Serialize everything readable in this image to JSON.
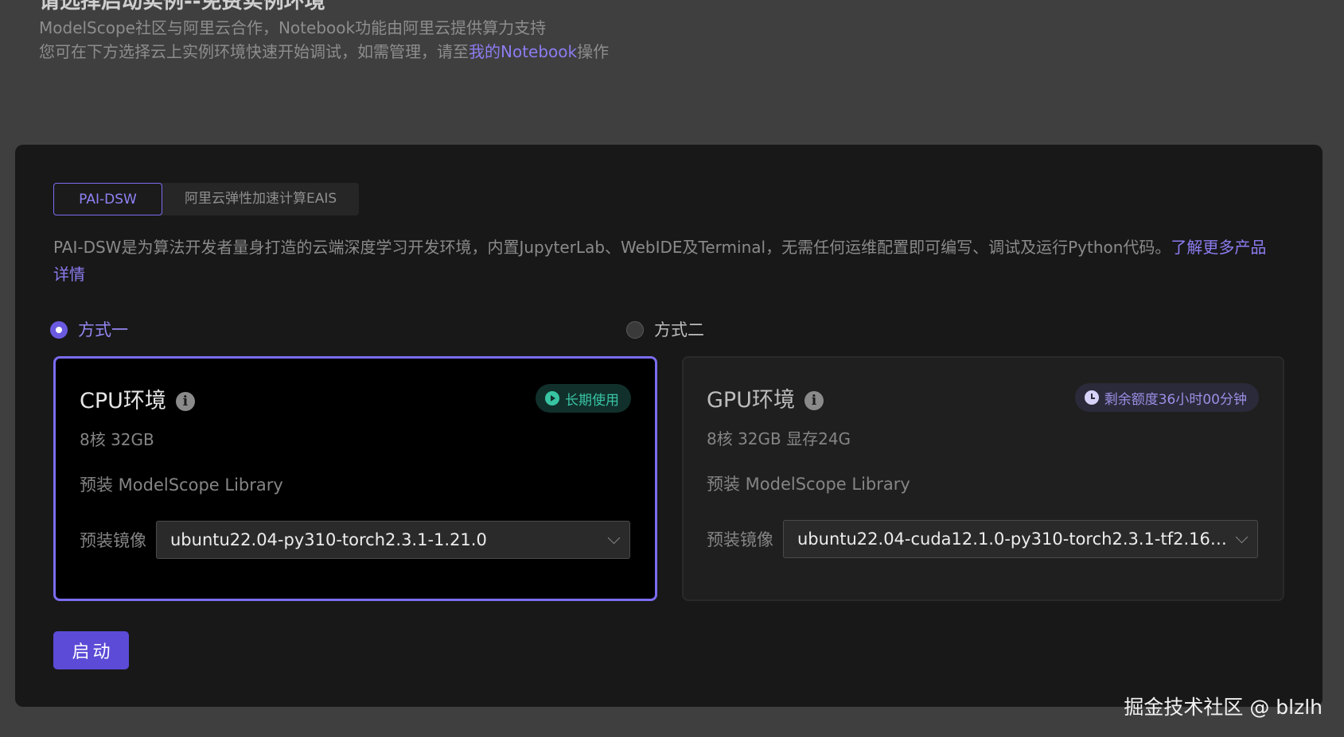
{
  "header": {
    "title": "请选择启动实例--免费实例环境",
    "subtitle_1": "ModelScope社区与阿里云合作，Notebook功能由阿里云提供算力支持",
    "subtitle_2_prefix": "您可在下方选择云上实例环境快速开始调试，如需管理，请至",
    "subtitle_2_link": "我的Notebook",
    "subtitle_2_suffix": "操作"
  },
  "tabs": [
    {
      "label": "PAI-DSW",
      "active": true
    },
    {
      "label": "阿里云弹性加速计算EAIS",
      "active": false
    }
  ],
  "description": {
    "text": "PAI-DSW是为算法开发者量身打造的云端深度学习开发环境，内置JupyterLab、WebIDE及Terminal，无需任何运维配置即可编写、调试及运行Python代码。",
    "link": "了解更多产品详情"
  },
  "options": [
    {
      "label": "方式一",
      "checked": true,
      "card": {
        "title": "CPU环境",
        "badge": "长期使用",
        "spec": "8核 32GB",
        "preinstall": "预装 ModelScope Library",
        "image_label": "预装镜像",
        "image_value": "ubuntu22.04-py310-torch2.3.1-1.21.0"
      }
    },
    {
      "label": "方式二",
      "checked": false,
      "card": {
        "title": "GPU环境",
        "badge": "剩余额度36小时00分钟",
        "spec": "8核 32GB 显存24G",
        "preinstall": "预装 ModelScope Library",
        "image_label": "预装镜像",
        "image_value": "ubuntu22.04-cuda12.1.0-py310-torch2.3.1-tf2.16.1-..."
      }
    }
  ],
  "start_button": "启动",
  "watermark": "掘金技术社区 @ blzlh",
  "colors": {
    "accent": "#7b6cf0",
    "primary_button": "#5b4bd6",
    "badge_green": "#38c4a3",
    "badge_purple": "#9a90e6"
  },
  "icons": {
    "info": "info-icon",
    "play": "play-circle-icon",
    "clock": "clock-icon",
    "chevron": "chevron-down-icon"
  }
}
